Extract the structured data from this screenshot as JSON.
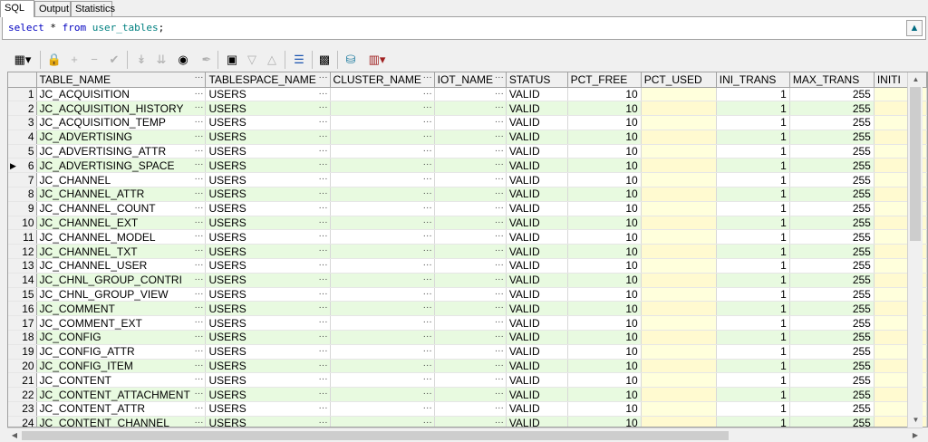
{
  "tabs": [
    {
      "label": "SQL",
      "active": true
    },
    {
      "label": "Output",
      "active": false
    },
    {
      "label": "Statistics",
      "active": false
    }
  ],
  "sql": {
    "keyword_select": "select",
    "star": " * ",
    "keyword_from": "from",
    "table": " user_tables",
    "semicolon": ";",
    "execute_icon": "arrow-up-icon"
  },
  "toolbar": {
    "icons": [
      "grid-menu-icon",
      "lock-icon",
      "plus-icon",
      "minus-icon",
      "check-icon",
      "post-icon",
      "refresh-icon",
      "binoculars-icon",
      "clear-icon",
      "export-icon",
      "filter-icon",
      "triangle-icon",
      "chart-icon",
      "save-icon",
      "database-icon",
      "graph-icon"
    ]
  },
  "grid": {
    "columns": [
      "TABLE_NAME",
      "TABLESPACE_NAME",
      "CLUSTER_NAME",
      "IOT_NAME",
      "STATUS",
      "PCT_FREE",
      "PCT_USED",
      "INI_TRANS",
      "MAX_TRANS",
      "INITI"
    ],
    "ellipsis": "···",
    "current_row": 6,
    "rows": [
      {
        "n": "1",
        "name": "JC_ACQUISITION",
        "ts": "USERS",
        "status": "VALID",
        "pct_free": "10",
        "ini": "1",
        "max": "255"
      },
      {
        "n": "2",
        "name": "JC_ACQUISITION_HISTORY",
        "ts": "USERS",
        "status": "VALID",
        "pct_free": "10",
        "ini": "1",
        "max": "255"
      },
      {
        "n": "3",
        "name": "JC_ACQUISITION_TEMP",
        "ts": "USERS",
        "status": "VALID",
        "pct_free": "10",
        "ini": "1",
        "max": "255"
      },
      {
        "n": "4",
        "name": "JC_ADVERTISING",
        "ts": "USERS",
        "status": "VALID",
        "pct_free": "10",
        "ini": "1",
        "max": "255"
      },
      {
        "n": "5",
        "name": "JC_ADVERTISING_ATTR",
        "ts": "USERS",
        "status": "VALID",
        "pct_free": "10",
        "ini": "1",
        "max": "255"
      },
      {
        "n": "6",
        "name": "JC_ADVERTISING_SPACE",
        "ts": "USERS",
        "status": "VALID",
        "pct_free": "10",
        "ini": "1",
        "max": "255"
      },
      {
        "n": "7",
        "name": "JC_CHANNEL",
        "ts": "USERS",
        "status": "VALID",
        "pct_free": "10",
        "ini": "1",
        "max": "255"
      },
      {
        "n": "8",
        "name": "JC_CHANNEL_ATTR",
        "ts": "USERS",
        "status": "VALID",
        "pct_free": "10",
        "ini": "1",
        "max": "255"
      },
      {
        "n": "9",
        "name": "JC_CHANNEL_COUNT",
        "ts": "USERS",
        "status": "VALID",
        "pct_free": "10",
        "ini": "1",
        "max": "255"
      },
      {
        "n": "10",
        "name": "JC_CHANNEL_EXT",
        "ts": "USERS",
        "status": "VALID",
        "pct_free": "10",
        "ini": "1",
        "max": "255"
      },
      {
        "n": "11",
        "name": "JC_CHANNEL_MODEL",
        "ts": "USERS",
        "status": "VALID",
        "pct_free": "10",
        "ini": "1",
        "max": "255"
      },
      {
        "n": "12",
        "name": "JC_CHANNEL_TXT",
        "ts": "USERS",
        "status": "VALID",
        "pct_free": "10",
        "ini": "1",
        "max": "255"
      },
      {
        "n": "13",
        "name": "JC_CHANNEL_USER",
        "ts": "USERS",
        "status": "VALID",
        "pct_free": "10",
        "ini": "1",
        "max": "255"
      },
      {
        "n": "14",
        "name": "JC_CHNL_GROUP_CONTRI",
        "ts": "USERS",
        "status": "VALID",
        "pct_free": "10",
        "ini": "1",
        "max": "255"
      },
      {
        "n": "15",
        "name": "JC_CHNL_GROUP_VIEW",
        "ts": "USERS",
        "status": "VALID",
        "pct_free": "10",
        "ini": "1",
        "max": "255"
      },
      {
        "n": "16",
        "name": "JC_COMMENT",
        "ts": "USERS",
        "status": "VALID",
        "pct_free": "10",
        "ini": "1",
        "max": "255"
      },
      {
        "n": "17",
        "name": "JC_COMMENT_EXT",
        "ts": "USERS",
        "status": "VALID",
        "pct_free": "10",
        "ini": "1",
        "max": "255"
      },
      {
        "n": "18",
        "name": "JC_CONFIG",
        "ts": "USERS",
        "status": "VALID",
        "pct_free": "10",
        "ini": "1",
        "max": "255"
      },
      {
        "n": "19",
        "name": "JC_CONFIG_ATTR",
        "ts": "USERS",
        "status": "VALID",
        "pct_free": "10",
        "ini": "1",
        "max": "255"
      },
      {
        "n": "20",
        "name": "JC_CONFIG_ITEM",
        "ts": "USERS",
        "status": "VALID",
        "pct_free": "10",
        "ini": "1",
        "max": "255"
      },
      {
        "n": "21",
        "name": "JC_CONTENT",
        "ts": "USERS",
        "status": "VALID",
        "pct_free": "10",
        "ini": "1",
        "max": "255"
      },
      {
        "n": "22",
        "name": "JC_CONTENT_ATTACHMENT",
        "ts": "USERS",
        "status": "VALID",
        "pct_free": "10",
        "ini": "1",
        "max": "255"
      },
      {
        "n": "23",
        "name": "JC_CONTENT_ATTR",
        "ts": "USERS",
        "status": "VALID",
        "pct_free": "10",
        "ini": "1",
        "max": "255"
      },
      {
        "n": "24",
        "name": "JC_CONTENT_CHANNEL",
        "ts": "USERS",
        "status": "VALID",
        "pct_free": "10",
        "ini": "1",
        "max": "255"
      }
    ]
  },
  "colors": {
    "keyword": "#0000c0",
    "identifier": "#008080",
    "alt_row": "#e8fae0",
    "pct_used": "#ffffdc"
  }
}
